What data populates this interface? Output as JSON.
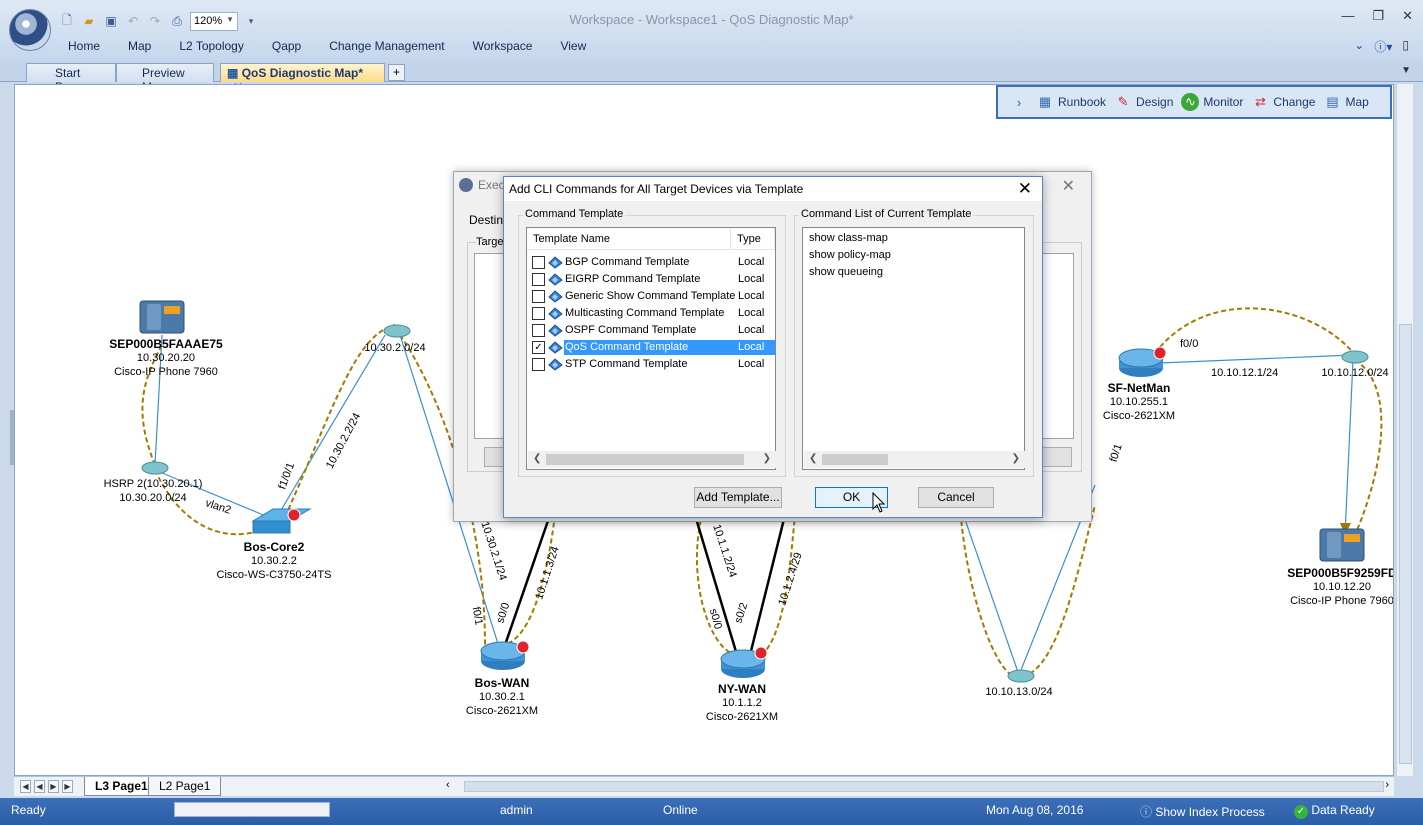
{
  "window": {
    "title": "Workspace - Workspace1 - QoS Diagnostic Map*",
    "zoom": "120%"
  },
  "menu": [
    "Home",
    "Map",
    "L2 Topology",
    "Qapp",
    "Change Management",
    "Workspace",
    "View"
  ],
  "tabs": {
    "start": "Start Page",
    "preview": "Preview Map",
    "qos": "QoS Diagnostic Map*",
    "close": "✕",
    "add": "+"
  },
  "float_toolbar": {
    "runbook": "Runbook",
    "design": "Design",
    "monitor": "Monitor",
    "change": "Change",
    "map": "Map"
  },
  "map": {
    "nodes": {
      "phone1": {
        "name": "SEP000B5FAAAE75",
        "ip": "10.30.20.20",
        "model": "Cisco-IP Phone 7960"
      },
      "hsrp": {
        "name": "HSRP 2(10.30.20.1)",
        "subnet": "10.30.20.0/24"
      },
      "bos_core": {
        "name": "Bos-Core2",
        "ip": "10.30.2.2",
        "model": "Cisco-WS-C3750-24TS"
      },
      "sub_302": {
        "name": "10.30.2.0/24"
      },
      "bos_wan": {
        "name": "Bos-WAN",
        "ip": "10.30.2.1",
        "model": "Cisco-2621XM"
      },
      "ny_wan": {
        "name": "NY-WAN",
        "ip": "10.1.1.2",
        "model": "Cisco-2621XM"
      },
      "sub_1013": {
        "name": "10.10.13.0/24"
      },
      "sf_netman": {
        "name": "SF-NetMan",
        "ip": "10.10.255.1",
        "model": "Cisco-2621XM"
      },
      "sub_1012": {
        "name": "10.10.12.0/24"
      },
      "phone2": {
        "name": "SEP000B5F9259FD",
        "ip": "10.10.12.20",
        "model": "Cisco-IP Phone 7960"
      }
    },
    "links": {
      "vlan2": "vlan2",
      "f1_0_1": "f1/0/1",
      "ip_30_2_2": "10.30.2.2/24",
      "ip_30_2_1": "10.30.2.1/24",
      "f0_1": "f0/1",
      "s0_0_bos": "s0/0",
      "ip_1_1_3": "10.1.1.3/24",
      "ip_1_1_2": "10.1.1.2/24",
      "s0_0_ny": "s0/0",
      "s0_2": "s0/2",
      "ip_1_2_4": "10.1.2.4/29",
      "f0_0": "f0/0",
      "ip_10_12_1": "10.10.12.1/24",
      "f0_1_sf": "f0/1"
    }
  },
  "back_dialog": {
    "title": "Exec",
    "dest": "Destina",
    "target": "Targe"
  },
  "dialog": {
    "title": "Add CLI Commands for All Target Devices via Template",
    "template_group": "Command Template",
    "commands_group": "Command List of Current Template",
    "col_name": "Template Name",
    "col_type": "Type",
    "templates": [
      {
        "name": "BGP Command Template",
        "type": "Local",
        "checked": false
      },
      {
        "name": "EIGRP Command Template",
        "type": "Local",
        "checked": false
      },
      {
        "name": "Generic Show Command Template",
        "type": "Local",
        "checked": false
      },
      {
        "name": "Multicasting Command Template",
        "type": "Local",
        "checked": false
      },
      {
        "name": "OSPF Command Template",
        "type": "Local",
        "checked": false
      },
      {
        "name": "QoS Command Template",
        "type": "Local",
        "checked": true
      },
      {
        "name": "STP Command Template",
        "type": "Local",
        "checked": false
      }
    ],
    "commands": [
      "show class-map",
      "show policy-map",
      "show queueing"
    ],
    "add_template": "Add Template...",
    "ok": "OK",
    "cancel": "Cancel"
  },
  "pages": {
    "l3": "L3 Page1",
    "l2": "L2 Page1"
  },
  "status": {
    "ready": "Ready",
    "user": "admin",
    "online": "Online",
    "date": "Mon Aug 08, 2016",
    "index": "Show Index Process",
    "data_ready": "Data Ready"
  }
}
